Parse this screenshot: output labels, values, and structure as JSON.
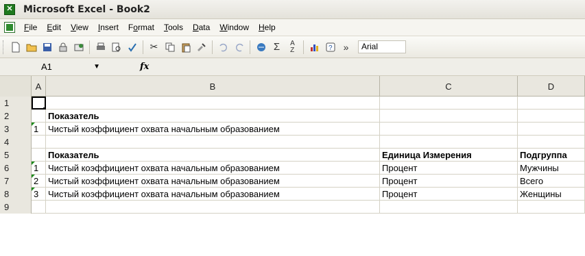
{
  "window": {
    "title": "Microsoft Excel - Book2"
  },
  "menu": [
    "File",
    "Edit",
    "View",
    "Insert",
    "Format",
    "Tools",
    "Data",
    "Window",
    "Help"
  ],
  "menu_underline": [
    "F",
    "E",
    "V",
    "I",
    "o",
    "T",
    "D",
    "W",
    "H"
  ],
  "toolbar": {
    "icons": [
      "new-icon",
      "open-icon",
      "save-icon",
      "permission-icon",
      "email-icon",
      "print-icon",
      "print-preview-icon",
      "spelling-icon",
      "cut-icon",
      "copy-icon",
      "paste-icon",
      "format-painter-icon",
      "undo-icon",
      "redo-icon",
      "hyperlink-icon",
      "autosum-icon",
      "sort-icon",
      "chart-wizard-icon",
      "help-icon",
      "more-icon"
    ],
    "font": "Arial"
  },
  "formula": {
    "cell_ref": "A1",
    "fx": "fx",
    "value": ""
  },
  "columns": [
    "A",
    "B",
    "C",
    "D"
  ],
  "rows": [
    {
      "num": "1",
      "a": "",
      "b": "",
      "c": "",
      "d": ""
    },
    {
      "num": "2",
      "a": "",
      "b": "Показатель",
      "c": "",
      "d": ""
    },
    {
      "num": "3",
      "a": "1",
      "b": "Чистый коэффициент охвата начальным образованием",
      "c": "",
      "d": ""
    },
    {
      "num": "4",
      "a": "",
      "b": "",
      "c": "",
      "d": ""
    },
    {
      "num": "5",
      "a": "",
      "b": "Показатель",
      "c": "Единица Измерения",
      "d": "Подгруппа"
    },
    {
      "num": "6",
      "a": "1",
      "b": "Чистый коэффициент охвата начальным образованием",
      "c": "Процент",
      "d": "Мужчины"
    },
    {
      "num": "7",
      "a": "2",
      "b": "Чистый коэффициент охвата начальным образованием",
      "c": "Процент",
      "d": "Всего"
    },
    {
      "num": "8",
      "a": "3",
      "b": "Чистый коэффициент охвата начальным образованием",
      "c": "Процент",
      "d": "Женщины"
    },
    {
      "num": "9",
      "a": "",
      "b": "",
      "c": "",
      "d": ""
    }
  ]
}
